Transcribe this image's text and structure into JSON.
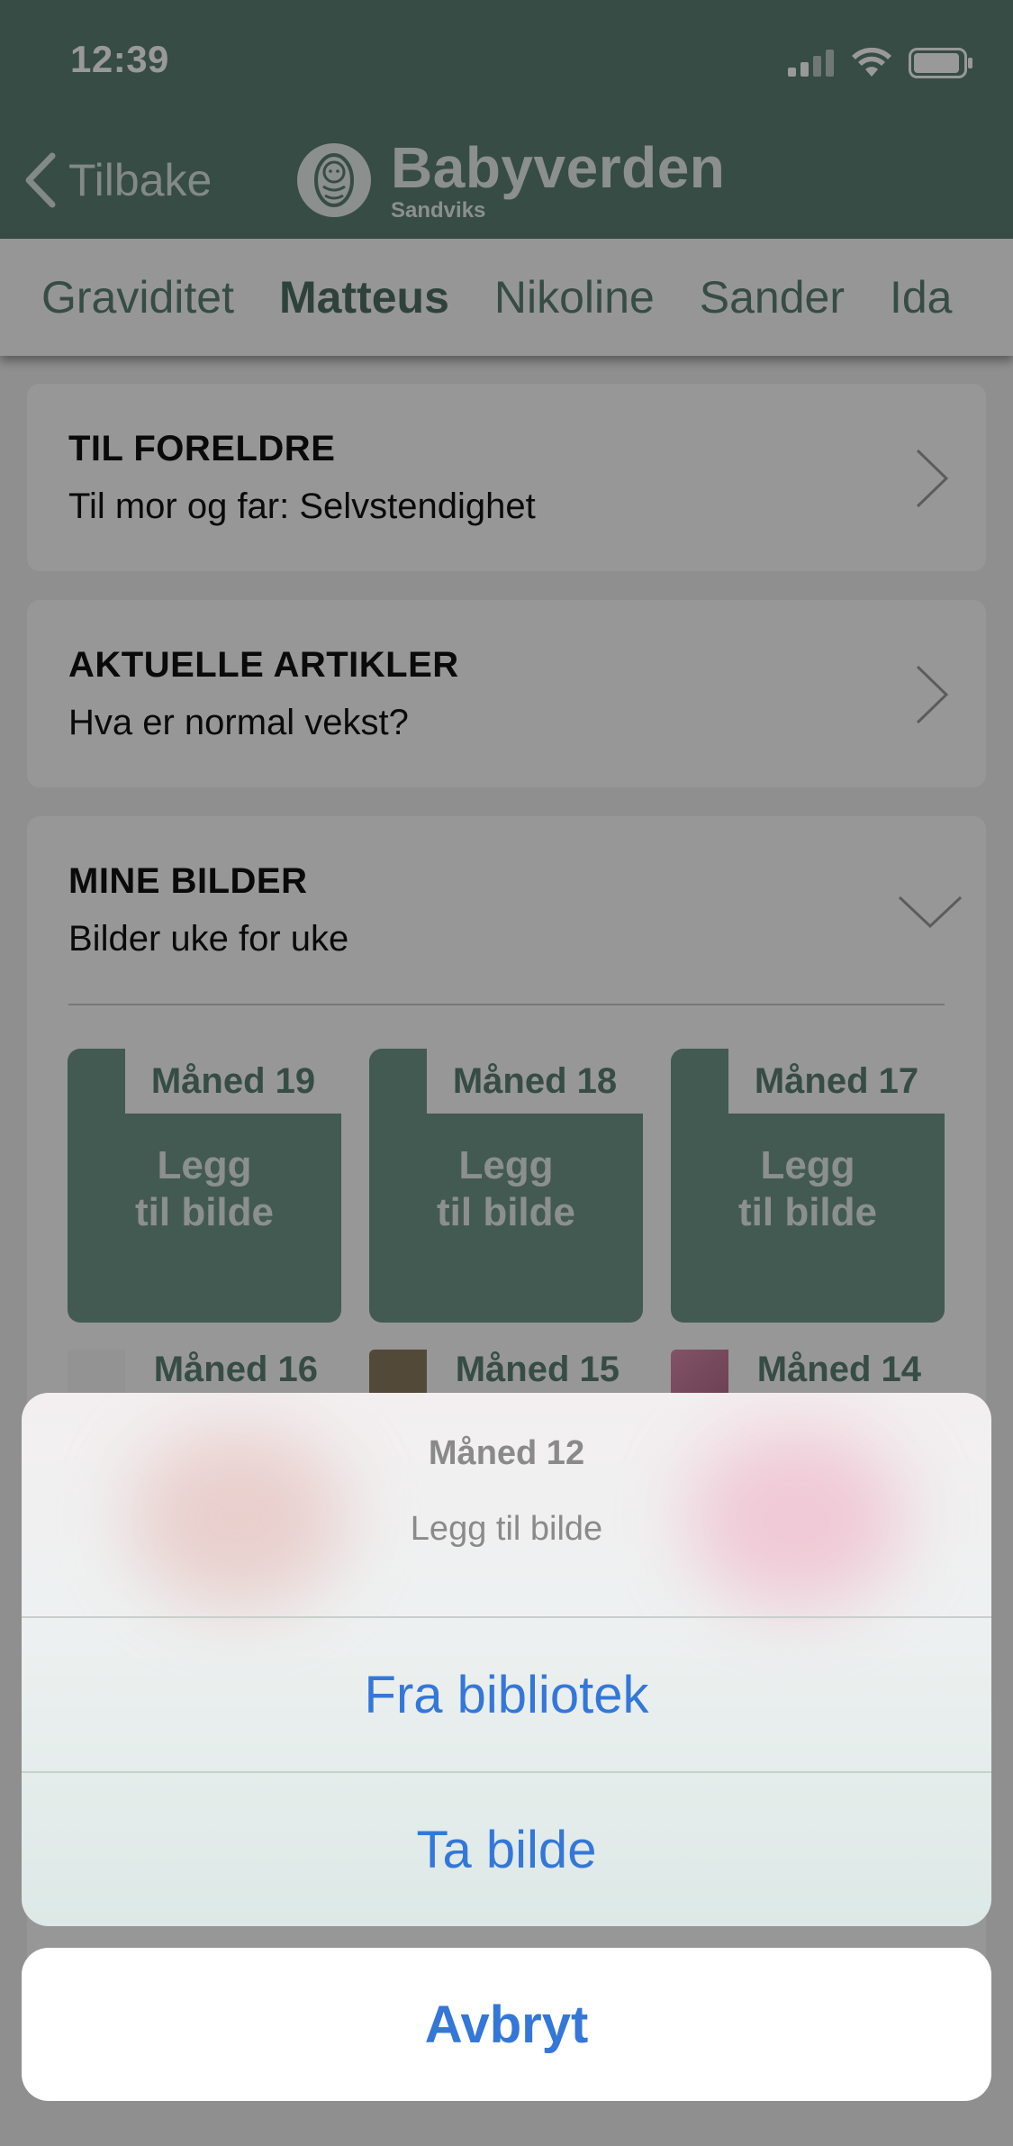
{
  "status_bar": {
    "time": "12:39"
  },
  "nav": {
    "back_label": "Tilbake",
    "brand_title": "Babyverden",
    "brand_subtitle": "Sandviks"
  },
  "tabs": [
    "Graviditet",
    "Matteus",
    "Nikoline",
    "Sander",
    "Ida"
  ],
  "active_tab": "Matteus",
  "cards": {
    "parents": {
      "title": "TIL FORELDRE",
      "subtitle": "Til mor og far: Selvstendighet"
    },
    "articles": {
      "title": "AKTUELLE ARTIKLER",
      "subtitle": "Hva er normal vekst?"
    },
    "photos": {
      "title": "MINE BILDER",
      "subtitle": "Bilder uke for uke"
    }
  },
  "photo_slots": [
    {
      "label": "Måned 19",
      "add_line1": "Legg",
      "add_line2": "til bilde"
    },
    {
      "label": "Måned 18",
      "add_line1": "Legg",
      "add_line2": "til bilde"
    },
    {
      "label": "Måned 17",
      "add_line1": "Legg",
      "add_line2": "til bilde"
    }
  ],
  "photo_slots_row2": [
    "Måned 16",
    "Måned 15",
    "Måned 14"
  ],
  "action_sheet": {
    "title": "Måned 12",
    "message": "Legg til bilde",
    "actions": [
      "Fra bibliotek",
      "Ta bilde"
    ],
    "cancel": "Avbryt"
  },
  "colors": {
    "brand_green": "#5b7f73",
    "action_blue": "#3477d8"
  }
}
